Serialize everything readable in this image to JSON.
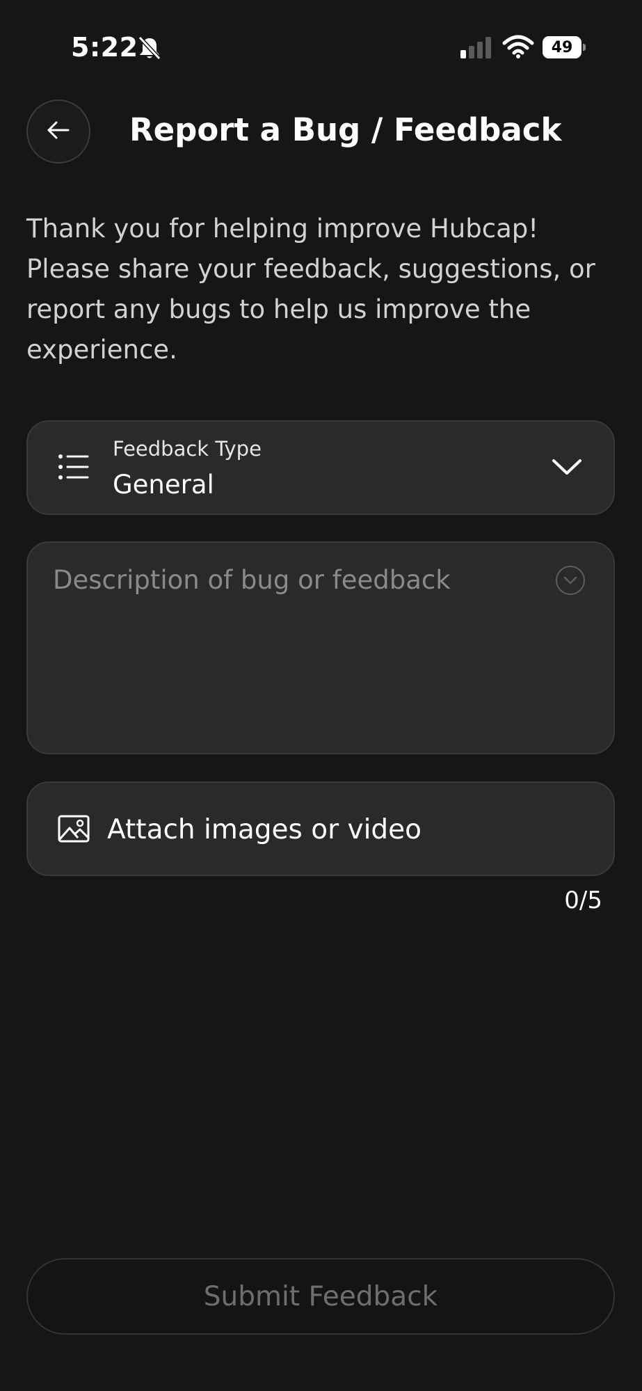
{
  "status_bar": {
    "time": "5:22",
    "battery": "49",
    "icons": [
      "bell-muted-icon",
      "signal-icon",
      "wifi-icon",
      "battery-icon"
    ]
  },
  "header": {
    "title": "Report a Bug / Feedback",
    "back_icon": "arrow-left-icon"
  },
  "intro_text": "Thank you for helping improve Hubcap! Please share your feedback, suggestions, or report any bugs to help us improve the experience.",
  "feedback_type": {
    "label": "Feedback Type",
    "value": "General",
    "icon": "list-icon",
    "dropdown_icon": "chevron-down-icon"
  },
  "description": {
    "placeholder": "Description of bug or feedback",
    "value": ""
  },
  "attachments": {
    "label": "Attach images or video",
    "icon": "image-icon",
    "count": "0/5"
  },
  "submit": {
    "label": "Submit Feedback"
  },
  "colors": {
    "background": "#161616",
    "card": "#2a2a2a",
    "card_border": "#3a3a3a",
    "text_primary": "#ffffff",
    "text_secondary": "#d2d2d2",
    "placeholder": "#8a8a8a",
    "disabled_text": "#6e6e6e"
  }
}
